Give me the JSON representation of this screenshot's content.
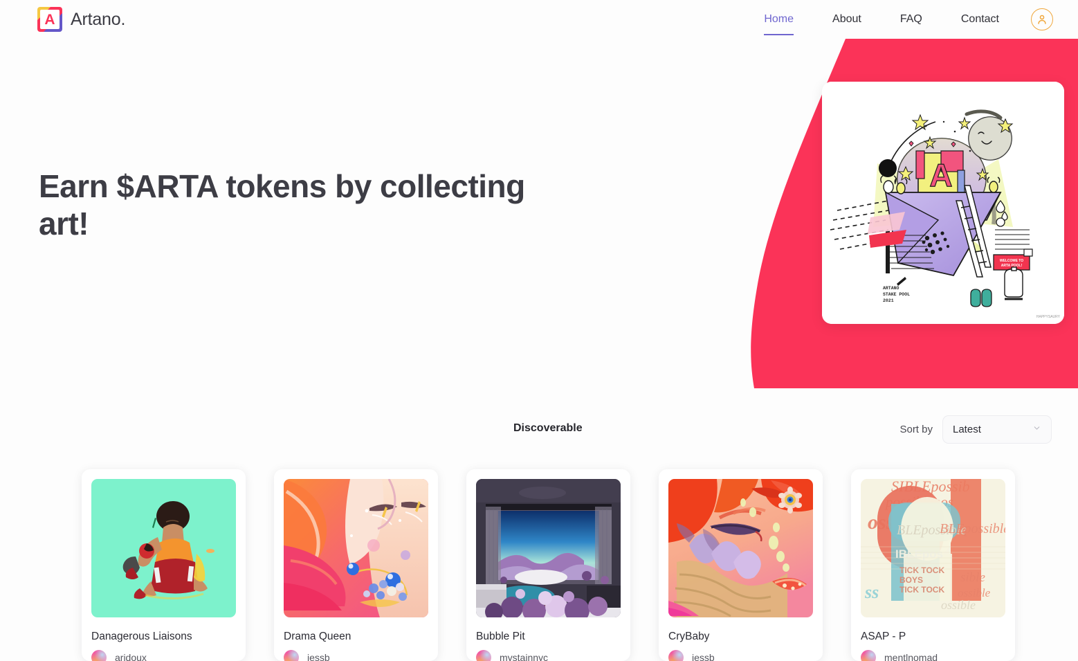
{
  "brand": {
    "name": "Artano.",
    "logo_letter": "A",
    "logo_colors": [
      "#f5c842",
      "#fb3358",
      "#6457c8"
    ]
  },
  "nav": {
    "items": [
      {
        "label": "Home",
        "active": true
      },
      {
        "label": "About",
        "active": false
      },
      {
        "label": "FAQ",
        "active": false
      },
      {
        "label": "Contact",
        "active": false
      }
    ],
    "account_icon": "user-avatar-icon"
  },
  "hero": {
    "title": "Earn $ARTA tokens by collecting art!",
    "accent_color": "#fb3358",
    "artwork": {
      "caption_line1": "ARTANO",
      "caption_line2": "STAKE POOL",
      "caption_line3": "2021",
      "sign_line1": "WELCOME TO",
      "sign_line2": "ARTA POOL!",
      "letter": "A",
      "signature": "HAPPYSAURY"
    },
    "carousel": {
      "total": 2,
      "active_index": 0
    }
  },
  "discover": {
    "heading": "Discoverable",
    "sort_label": "Sort by",
    "sort_value": "Latest",
    "sort_options": [
      "Latest"
    ],
    "chevron_icon": "chevron-down-icon"
  },
  "cards": [
    {
      "title": "Danagerous Liaisons",
      "owner": "aridoux"
    },
    {
      "title": "Drama Queen",
      "owner": "jessb"
    },
    {
      "title": "Bubble Pit",
      "owner": "mystainnyc"
    },
    {
      "title": "CryBaby",
      "owner": "jessb"
    },
    {
      "title": "ASAP - P",
      "owner": "mentlnomad"
    }
  ],
  "art_texts": {
    "asap_words": [
      "possiblepos",
      "SIBLEpossib",
      "ossible",
      "BLEpossible",
      "IBLEpos",
      "TICK TOCK",
      "BOYS",
      "TICK TOCK",
      "ss",
      "sible"
    ]
  }
}
